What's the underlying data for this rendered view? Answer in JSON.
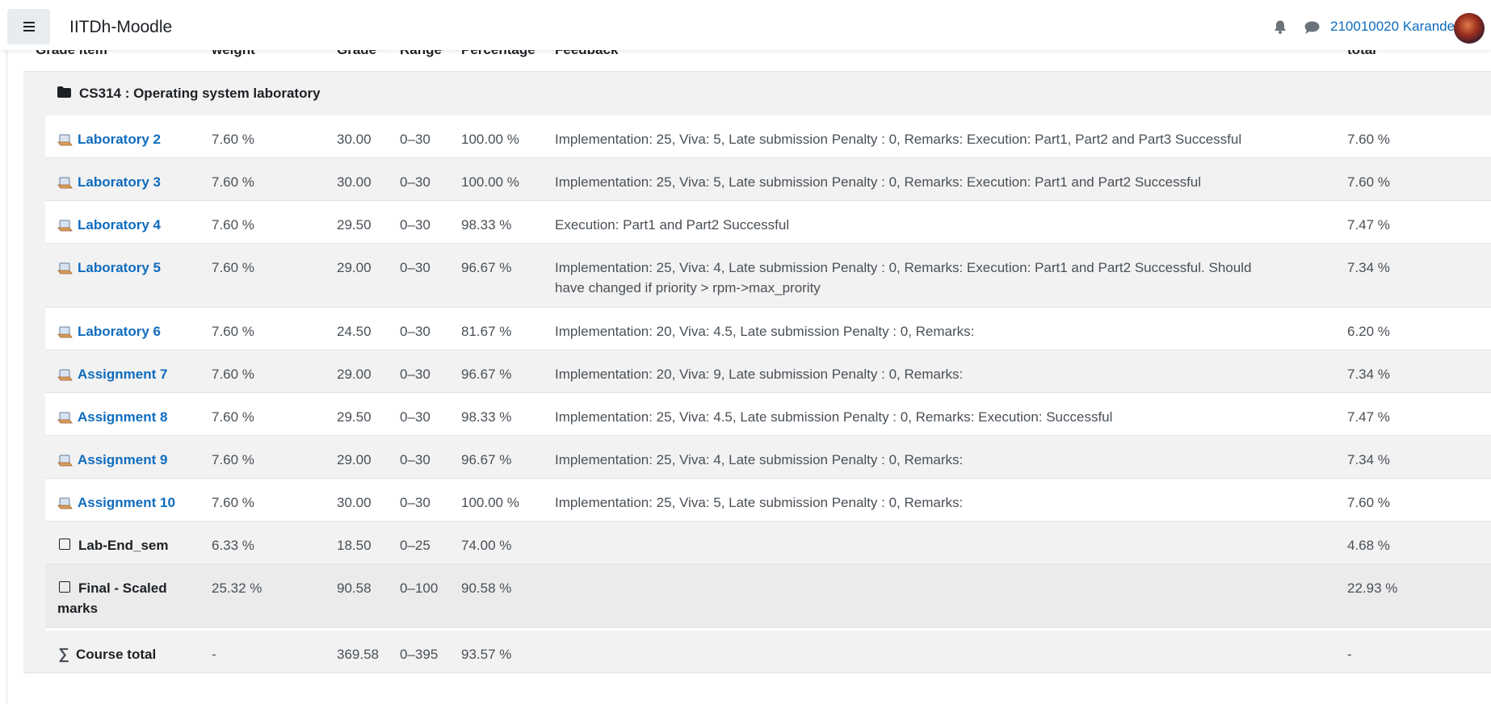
{
  "navbar": {
    "site_name": "IITDh-Moodle",
    "user_name": "210010020 Karande"
  },
  "table": {
    "headers": {
      "grade_item": "Grade item",
      "weight": "weight",
      "grade": "Grade",
      "range": "Range",
      "percentage": "Percentage",
      "feedback": "Feedback",
      "total": "total"
    },
    "category": "CS314 : Operating system laboratory",
    "rows": [
      {
        "name": "Laboratory 2",
        "weight": "7.60 %",
        "grade": "30.00",
        "range": "0–30",
        "percentage": "100.00 %",
        "feedback": "Implementation: 25, Viva: 5, Late submission Penalty : 0, Remarks: Execution: Part1, Part2 and Part3 Successful",
        "total": "7.60 %"
      },
      {
        "name": "Laboratory 3",
        "weight": "7.60 %",
        "grade": "30.00",
        "range": "0–30",
        "percentage": "100.00 %",
        "feedback": "Implementation: 25, Viva: 5, Late submission Penalty : 0, Remarks: Execution: Part1 and Part2 Successful",
        "total": "7.60 %"
      },
      {
        "name": "Laboratory 4",
        "weight": "7.60 %",
        "grade": "29.50",
        "range": "0–30",
        "percentage": "98.33 %",
        "feedback": "Execution: Part1 and Part2 Successful",
        "total": "7.47 %"
      },
      {
        "name": "Laboratory 5",
        "weight": "7.60 %",
        "grade": "29.00",
        "range": "0–30",
        "percentage": "96.67 %",
        "feedback": "Implementation: 25, Viva: 4, Late submission Penalty : 0, Remarks: Execution: Part1 and Part2 Successful. Should have changed if priority > rpm->max_prority",
        "total": "7.34 %"
      },
      {
        "name": "Laboratory 6",
        "weight": "7.60 %",
        "grade": "24.50",
        "range": "0–30",
        "percentage": "81.67 %",
        "feedback": "Implementation: 20, Viva: 4.5, Late submission Penalty : 0, Remarks:",
        "total": "6.20 %"
      },
      {
        "name": "Assignment 7",
        "weight": "7.60 %",
        "grade": "29.00",
        "range": "0–30",
        "percentage": "96.67 %",
        "feedback": "Implementation: 20, Viva: 9, Late submission Penalty : 0, Remarks:",
        "total": "7.34 %"
      },
      {
        "name": "Assignment 8",
        "weight": "7.60 %",
        "grade": "29.50",
        "range": "0–30",
        "percentage": "98.33 %",
        "feedback": "Implementation: 25, Viva: 4.5, Late submission Penalty : 0, Remarks: Execution: Successful",
        "total": "7.47 %"
      },
      {
        "name": "Assignment 9",
        "weight": "7.60 %",
        "grade": "29.00",
        "range": "0–30",
        "percentage": "96.67 %",
        "feedback": "Implementation: 25, Viva: 4, Late submission Penalty : 0, Remarks:",
        "total": "7.34 %"
      },
      {
        "name": "Assignment 10",
        "weight": "7.60 %",
        "grade": "30.00",
        "range": "0–30",
        "percentage": "100.00 %",
        "feedback": "Implementation: 25, Viva: 5, Late submission Penalty : 0, Remarks:",
        "total": "7.60 %"
      }
    ],
    "lab_end_sem": {
      "name": "Lab-End_sem",
      "weight": "6.33 %",
      "grade": "18.50",
      "range": "0–25",
      "percentage": "74.00 %",
      "feedback": "",
      "total": "4.68 %"
    },
    "final_scaled": {
      "name": "Final - Scaled marks",
      "weight": "25.32 %",
      "grade": "90.58",
      "range": "0–100",
      "percentage": "90.58 %",
      "feedback": "",
      "total": "22.93 %"
    },
    "course_total": {
      "name": "Course total",
      "weight": "-",
      "grade": "369.58",
      "range": "0–395",
      "percentage": "93.57 %",
      "feedback": "",
      "total": "-"
    }
  }
}
